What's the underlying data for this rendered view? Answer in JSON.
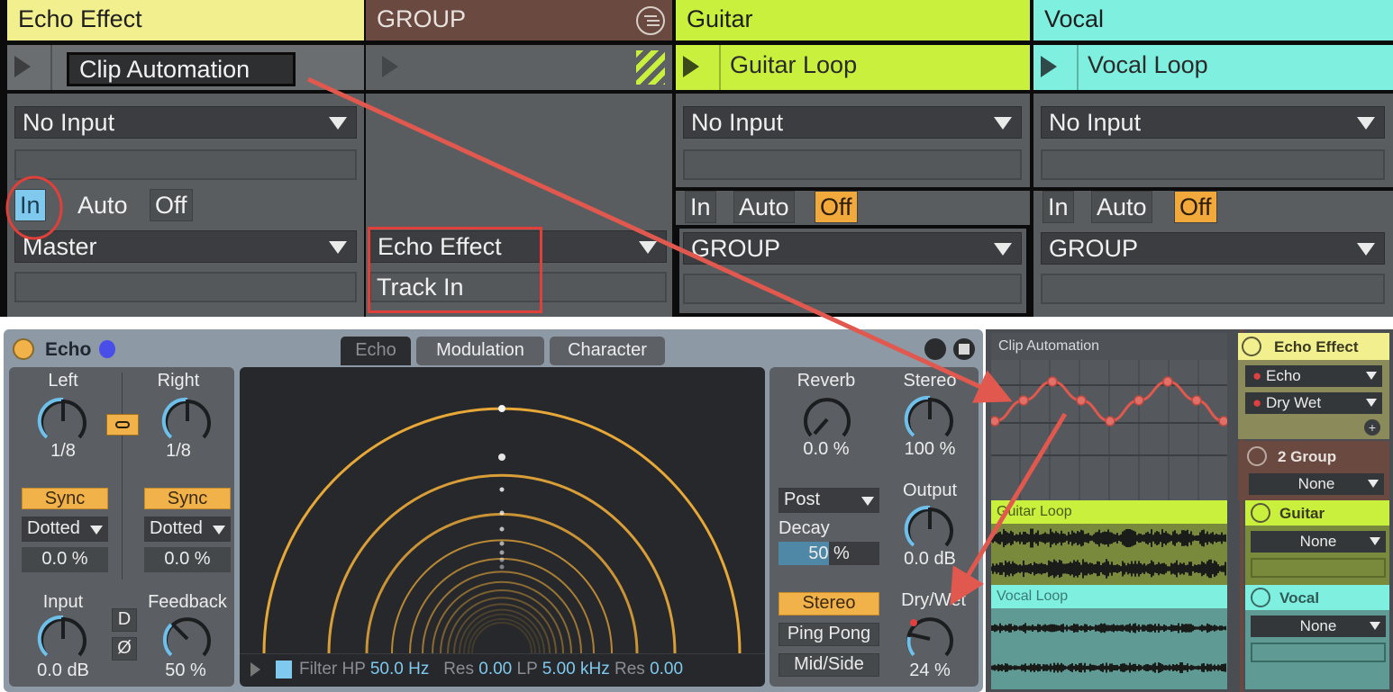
{
  "session": {
    "tracks": [
      {
        "name": "Echo Effect",
        "color": "#f2ef8f",
        "clip": "Clip Automation",
        "input": "No Input",
        "monitor": [
          "In",
          "Auto",
          "Off"
        ],
        "monitor_active": "In",
        "output": "Master",
        "output_sub": ""
      },
      {
        "name": "GROUP",
        "color": "#6a4a40",
        "clip": "",
        "output": "Echo Effect",
        "output_sub": "Track In"
      },
      {
        "name": "Guitar",
        "color": "#c8f03c",
        "clip": "Guitar Loop",
        "input": "No Input",
        "monitor": [
          "In",
          "Auto",
          "Off"
        ],
        "monitor_active": "Off",
        "output": "GROUP",
        "output_sub": ""
      },
      {
        "name": "Vocal",
        "color": "#7ff0e0",
        "clip": "Vocal Loop",
        "input": "No Input",
        "monitor": [
          "In",
          "Auto",
          "Off"
        ],
        "monitor_active": "Off",
        "output": "GROUP",
        "output_sub": ""
      }
    ]
  },
  "echo_device": {
    "title": "Echo",
    "tabs": [
      "Echo",
      "Modulation",
      "Character"
    ],
    "active_tab": "Echo",
    "left": {
      "label": "Left",
      "value": "1/8",
      "sync": "Sync",
      "mode": "Dotted",
      "offset": "0.0 %"
    },
    "right": {
      "label": "Right",
      "value": "1/8",
      "sync": "Sync",
      "mode": "Dotted",
      "offset": "0.0 %"
    },
    "input": {
      "label": "Input",
      "value": "0.0 dB"
    },
    "feedback": {
      "label": "Feedback",
      "value": "50 %",
      "percent": 50
    },
    "d_button": "D",
    "phase_button": "Ø",
    "filter": {
      "label": "Filter",
      "hp_label": "HP",
      "hp": "50.0 Hz",
      "res1_label": "Res",
      "res1": "0.00",
      "lp_label": "LP",
      "lp": "5.00 kHz",
      "res2_label": "Res",
      "res2": "0.00"
    },
    "reverb": {
      "label": "Reverb",
      "value": "0.0 %"
    },
    "stereo": {
      "label": "Stereo",
      "value": "100 %"
    },
    "reverb_pos": "Post",
    "decay": {
      "label": "Decay",
      "value": "50 %",
      "percent": 50
    },
    "output": {
      "label": "Output",
      "value": "0.0 dB"
    },
    "modes": [
      "Stereo",
      "Ping Pong",
      "Mid/Side"
    ],
    "active_mode": "Stereo",
    "drywet": {
      "label": "Dry/Wet",
      "value": "24 %",
      "percent": 24
    }
  },
  "arrangement": {
    "automation_clip": "Clip Automation",
    "guitar_clip": "Guitar Loop",
    "vocal_clip": "Vocal Loop",
    "mixer": [
      {
        "name": "Echo Effect",
        "color": "#f2ef8f",
        "devices": [
          "Echo",
          "Dry Wet"
        ]
      },
      {
        "name": "2 Group",
        "color": "#6a4a40",
        "select": "None"
      },
      {
        "name": "Guitar",
        "color": "#c8f03c",
        "select": "None"
      },
      {
        "name": "Vocal",
        "color": "#7ff0e0",
        "select": "None"
      }
    ]
  },
  "colors": {
    "annotation": "#e0584e",
    "accent_orange": "#f2b24a",
    "accent_blue": "#7fc9ee"
  }
}
